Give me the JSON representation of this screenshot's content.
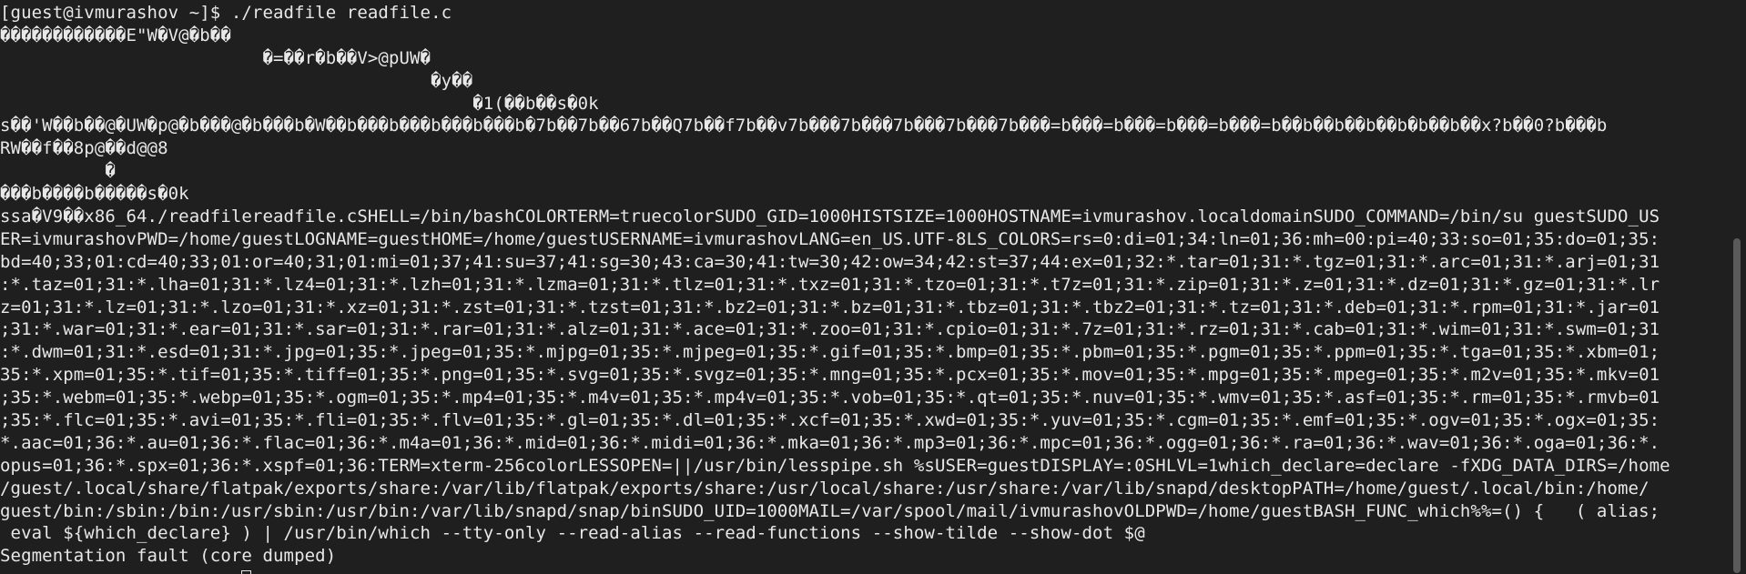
{
  "terminal": {
    "lines": [
      "[guest@ivmurashov ~]$ ./readfile readfile.c",
      "������������E\"W�V@�b��",
      "                         �=��r�b��V>@pUW�",
      "                                         �y��",
      "                                             �1(��b��s�0k",
      "s��'W��b��@�UW�p@�b���@�b���b�W��b���b���b���b���b�7b��7b��67b��Q7b��f7b��v7b���7b���7b���7b���7b���=b���=b���=b���=b���=b��b��b��b��b�b��b��x?b��0?b���b",
      "RW��f��8p@��d@@8",
      "          �",
      "���b����b�����s�0k",
      "ssa�V9��x86_64./readfilereadfile.cSHELL=/bin/bashCOLORTERM=truecolorSUDO_GID=1000HISTSIZE=1000HOSTNAME=ivmurashov.localdomainSUDO_COMMAND=/bin/su guestSUDO_US",
      "ER=ivmurashovPWD=/home/guestLOGNAME=guestHOME=/home/guestUSERNAME=ivmurashovLANG=en_US.UTF-8LS_COLORS=rs=0:di=01;34:ln=01;36:mh=00:pi=40;33:so=01;35:do=01;35:",
      "bd=40;33;01:cd=40;33;01:or=40;31;01:mi=01;37;41:su=37;41:sg=30;43:ca=30;41:tw=30;42:ow=34;42:st=37;44:ex=01;32:*.tar=01;31:*.tgz=01;31:*.arc=01;31:*.arj=01;31",
      ":*.taz=01;31:*.lha=01;31:*.lz4=01;31:*.lzh=01;31:*.lzma=01;31:*.tlz=01;31:*.txz=01;31:*.tzo=01;31:*.t7z=01;31:*.zip=01;31:*.z=01;31:*.dz=01;31:*.gz=01;31:*.lr",
      "z=01;31:*.lz=01;31:*.lzo=01;31:*.xz=01;31:*.zst=01;31:*.tzst=01;31:*.bz2=01;31:*.bz=01;31:*.tbz=01;31:*.tbz2=01;31:*.tz=01;31:*.deb=01;31:*.rpm=01;31:*.jar=01",
      ";31:*.war=01;31:*.ear=01;31:*.sar=01;31:*.rar=01;31:*.alz=01;31:*.ace=01;31:*.zoo=01;31:*.cpio=01;31:*.7z=01;31:*.rz=01;31:*.cab=01;31:*.wim=01;31:*.swm=01;31",
      ":*.dwm=01;31:*.esd=01;31:*.jpg=01;35:*.jpeg=01;35:*.mjpg=01;35:*.mjpeg=01;35:*.gif=01;35:*.bmp=01;35:*.pbm=01;35:*.pgm=01;35:*.ppm=01;35:*.tga=01;35:*.xbm=01;",
      "35:*.xpm=01;35:*.tif=01;35:*.tiff=01;35:*.png=01;35:*.svg=01;35:*.svgz=01;35:*.mng=01;35:*.pcx=01;35:*.mov=01;35:*.mpg=01;35:*.mpeg=01;35:*.m2v=01;35:*.mkv=01",
      ";35:*.webm=01;35:*.webp=01;35:*.ogm=01;35:*.mp4=01;35:*.m4v=01;35:*.mp4v=01;35:*.vob=01;35:*.qt=01;35:*.nuv=01;35:*.wmv=01;35:*.asf=01;35:*.rm=01;35:*.rmvb=01",
      ";35:*.flc=01;35:*.avi=01;35:*.fli=01;35:*.flv=01;35:*.gl=01;35:*.dl=01;35:*.xcf=01;35:*.xwd=01;35:*.yuv=01;35:*.cgm=01;35:*.emf=01;35:*.ogv=01;35:*.ogx=01;35:",
      "*.aac=01;36:*.au=01;36:*.flac=01;36:*.m4a=01;36:*.mid=01;36:*.midi=01;36:*.mka=01;36:*.mp3=01;36:*.mpc=01;36:*.ogg=01;36:*.ra=01;36:*.wav=01;36:*.oga=01;36:*.",
      "opus=01;36:*.spx=01;36:*.xspf=01;36:TERM=xterm-256colorLESSOPEN=||/usr/bin/lesspipe.sh %sUSER=guestDISPLAY=:0SHLVL=1which_declare=declare -fXDG_DATA_DIRS=/home",
      "/guest/.local/share/flatpak/exports/share:/var/lib/flatpak/exports/share:/usr/local/share:/usr/share:/var/lib/snapd/desktopPATH=/home/guest/.local/bin:/home/",
      "guest/bin:/sbin:/bin:/usr/sbin:/usr/bin:/var/lib/snapd/snap/binSUDO_UID=1000MAIL=/var/spool/mail/ivmurashovOLDPWD=/home/guestBASH_FUNC_which%%=() {   ( alias;",
      " eval ${which_declare} ) | /usr/bin/which --tty-only --read-alias --read-functions --show-tilde --show-dot $@",
      "Segmentation fault (core dumped)"
    ]
  }
}
